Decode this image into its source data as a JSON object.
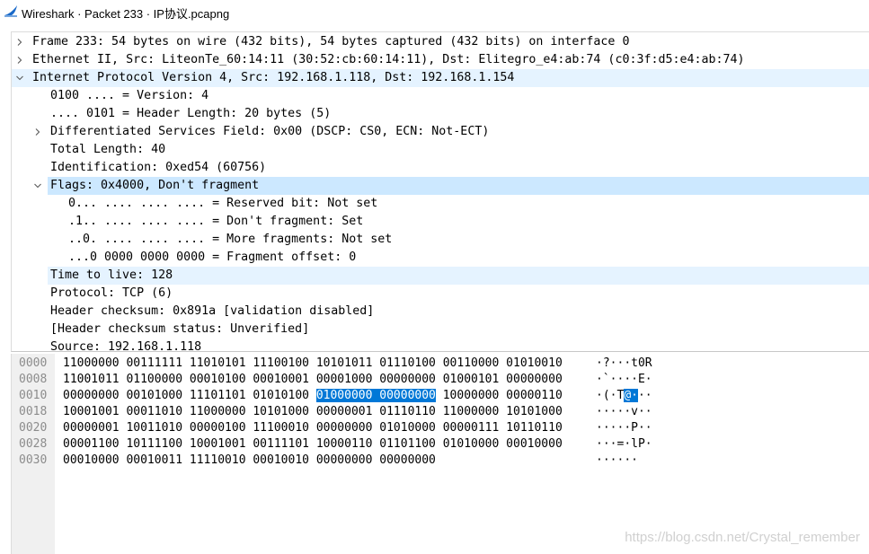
{
  "window": {
    "title": "Wireshark · Packet 233 · IP协议.pcapng",
    "icon": "wireshark-fin-icon",
    "accent": "#1a6ac9"
  },
  "packet_tree": [
    {
      "level": 0,
      "expander": "collapsed",
      "text": "Frame 233: 54 bytes on wire (432 bits), 54 bytes captured (432 bits) on interface 0"
    },
    {
      "level": 0,
      "expander": "collapsed",
      "text": "Ethernet II, Src: LiteonTe_60:14:11 (30:52:cb:60:14:11), Dst: Elitegro_e4:ab:74 (c0:3f:d5:e4:ab:74)"
    },
    {
      "level": 0,
      "expander": "expanded",
      "text": "Internet Protocol Version 4, Src: 192.168.1.118, Dst: 192.168.1.154",
      "highlight": "soft"
    },
    {
      "level": 1,
      "expander": "none",
      "text": "0100 .... = Version: 4"
    },
    {
      "level": 1,
      "expander": "none",
      "text": ".... 0101 = Header Length: 20 bytes (5)"
    },
    {
      "level": 1,
      "expander": "collapsed",
      "text": "Differentiated Services Field: 0x00 (DSCP: CS0, ECN: Not-ECT)"
    },
    {
      "level": 1,
      "expander": "none",
      "text": "Total Length: 40"
    },
    {
      "level": 1,
      "expander": "none",
      "text": "Identification: 0xed54 (60756)"
    },
    {
      "level": 1,
      "expander": "expanded",
      "text": "Flags: 0x4000, Don't fragment",
      "highlight": "selected"
    },
    {
      "level": 2,
      "expander": "none",
      "text": "0... .... .... .... = Reserved bit: Not set"
    },
    {
      "level": 2,
      "expander": "none",
      "text": ".1.. .... .... .... = Don't fragment: Set"
    },
    {
      "level": 2,
      "expander": "none",
      "text": "..0. .... .... .... = More fragments: Not set"
    },
    {
      "level": 2,
      "expander": "none",
      "text": "...0 0000 0000 0000 = Fragment offset: 0"
    },
    {
      "level": 1,
      "expander": "none",
      "text": "Time to live: 128",
      "highlight": "soft"
    },
    {
      "level": 1,
      "expander": "none",
      "text": "Protocol: TCP (6)"
    },
    {
      "level": 1,
      "expander": "none",
      "text": "Header checksum: 0x891a [validation disabled]"
    },
    {
      "level": 1,
      "expander": "none",
      "text": "[Header checksum status: Unverified]"
    },
    {
      "level": 1,
      "expander": "none",
      "text": "Source: 192.168.1.118"
    }
  ],
  "hex_rows": [
    {
      "offset": "0000",
      "bytes": [
        "11000000",
        "00111111",
        "11010101",
        "11100100",
        "10101011",
        "01110100",
        "00110000",
        "01010010"
      ],
      "ascii": [
        "·",
        "?",
        "·",
        "·",
        "·",
        "t",
        "0",
        "R"
      ]
    },
    {
      "offset": "0008",
      "bytes": [
        "11001011",
        "01100000",
        "00010100",
        "00010001",
        "00001000",
        "00000000",
        "01000101",
        "00000000"
      ],
      "ascii": [
        "·",
        "`",
        "·",
        "·",
        "·",
        "·",
        "E",
        "·"
      ]
    },
    {
      "offset": "0010",
      "bytes": [
        "00000000",
        "00101000",
        "11101101",
        "01010100",
        "01000000",
        "00000000",
        "10000000",
        "00000110"
      ],
      "ascii": [
        "·",
        "(",
        "·",
        "T",
        "@",
        "·",
        "·",
        "·"
      ],
      "selected": [
        4,
        5
      ]
    },
    {
      "offset": "0018",
      "bytes": [
        "10001001",
        "00011010",
        "11000000",
        "10101000",
        "00000001",
        "01110110",
        "11000000",
        "10101000"
      ],
      "ascii": [
        "·",
        "·",
        "·",
        "·",
        "·",
        "v",
        "·",
        "·"
      ]
    },
    {
      "offset": "0020",
      "bytes": [
        "00000001",
        "10011010",
        "00000100",
        "11100010",
        "00000000",
        "01010000",
        "00000111",
        "10110110"
      ],
      "ascii": [
        "·",
        "·",
        "·",
        "·",
        "·",
        "P",
        "·",
        "·"
      ]
    },
    {
      "offset": "0028",
      "bytes": [
        "00001100",
        "10111100",
        "10001001",
        "00111101",
        "10000110",
        "01101100",
        "01010000",
        "00010000"
      ],
      "ascii": [
        "·",
        "·",
        "·",
        "=",
        "·",
        "l",
        "P",
        "·"
      ]
    },
    {
      "offset": "0030",
      "bytes": [
        "00010000",
        "00010011",
        "11110010",
        "00010010",
        "00000000",
        "00000000"
      ],
      "ascii": [
        "·",
        "·",
        "·",
        "·",
        "·",
        "·"
      ]
    }
  ],
  "watermark": "https://blog.csdn.net/Crystal_remember"
}
